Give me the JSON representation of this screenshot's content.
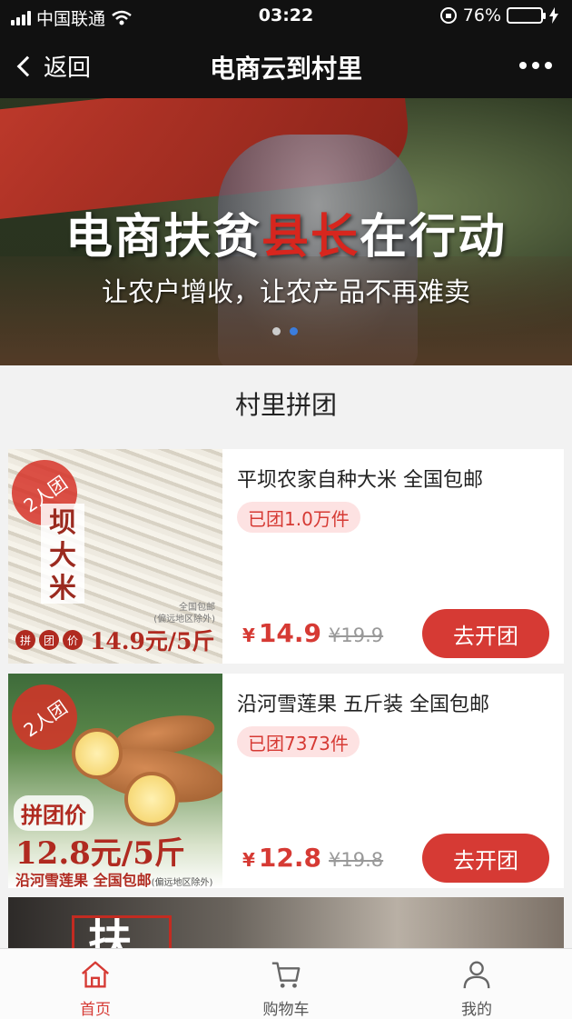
{
  "status_bar": {
    "carrier": "中国联通",
    "time": "03:22",
    "battery": "76%",
    "battery_fraction": 0.76
  },
  "nav": {
    "back_label": "返回",
    "title": "电商云到村里"
  },
  "banner": {
    "title_part1": "电商扶贫",
    "title_accent": "县长",
    "title_part2": "在行动",
    "subtitle": "让农户增收，让农产品不再难卖",
    "active_slide": 2,
    "slide_count": 2
  },
  "section": {
    "title": "村里拼团"
  },
  "products": [
    {
      "name": "平坝农家自种大米 全国包邮",
      "sold": "已团1.0万件",
      "currency": "¥",
      "price": "14.9",
      "old_price": "¥19.9",
      "button": "去开团",
      "image": {
        "group_tag": "2人团",
        "label": "坝大米",
        "pin_chars": [
          "拼",
          "团",
          "价"
        ],
        "price_text": "14.9元/5斤",
        "small_line1": "全国包邮",
        "small_line2": "(偏远地区除外)"
      }
    },
    {
      "name": "沿河雪莲果 五斤装 全国包邮",
      "sold": "已团7373件",
      "currency": "¥",
      "price": "12.8",
      "old_price": "¥19.8",
      "button": "去开团",
      "image": {
        "group_tag": "2人团",
        "tag2": "拼团价",
        "price_text": "12.8元/5斤",
        "sub_text": "沿河雪莲果 全国包邮",
        "sub_small": "(偏远地区除外)"
      }
    }
  ],
  "next_card": {
    "glyph": "扶"
  },
  "tabs": [
    {
      "label": "首页",
      "icon": "home-icon",
      "active": true
    },
    {
      "label": "购物车",
      "icon": "cart-icon",
      "active": false
    },
    {
      "label": "我的",
      "icon": "user-icon",
      "active": false
    }
  ],
  "colors": {
    "accent": "#d63a34",
    "badge_bg": "#fde2e2",
    "bar_bg": "#111111"
  }
}
